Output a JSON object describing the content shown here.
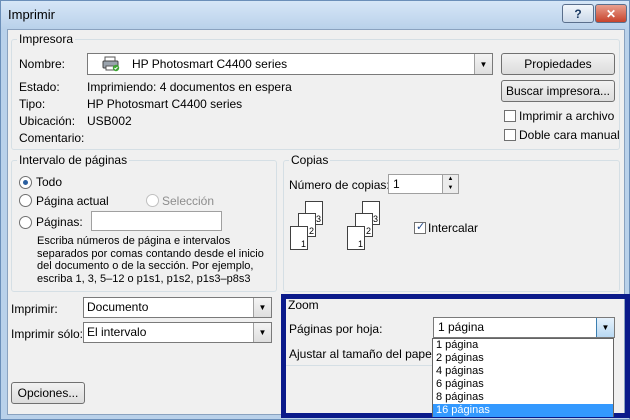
{
  "window": {
    "title": "Imprimir"
  },
  "printer": {
    "group_label": "Impresora",
    "name_label": "Nombre:",
    "name_value": "HP Photosmart C4400 series",
    "status_label": "Estado:",
    "status_value": "Imprimiendo: 4 documentos en espera",
    "type_label": "Tipo:",
    "type_value": "HP Photosmart C4400 series",
    "location_label": "Ubicación:",
    "location_value": "USB002",
    "comment_label": "Comentario:",
    "properties_button": "Propiedades",
    "find_button": "Buscar impresora...",
    "print_to_file": "Imprimir a archivo",
    "duplex": "Doble cara manual"
  },
  "page_range": {
    "group_label": "Intervalo de páginas",
    "all": "Todo",
    "current": "Página actual",
    "selection": "Selección",
    "pages": "Páginas:",
    "help_text": "Escriba números de página e intervalos separados por comas contando desde el inicio del documento o de la sección. Por ejemplo, escriba 1, 3, 5–12 o p1s1, p1s2, p1s3–p8s3"
  },
  "copies": {
    "group_label": "Copias",
    "count_label": "Número de copias:",
    "count_value": "1",
    "collate_label": "Intercalar",
    "page_nums": [
      "1",
      "2",
      "3"
    ]
  },
  "print_what": {
    "label": "Imprimir:",
    "value": "Documento"
  },
  "print_only": {
    "label": "Imprimir sólo:",
    "value": "El intervalo"
  },
  "zoom": {
    "group_label": "Zoom",
    "pages_per_sheet_label": "Páginas por hoja:",
    "pages_per_sheet_value": "1 página",
    "scale_label": "Ajustar al tamaño del papel:",
    "options": [
      "1 página",
      "2 páginas",
      "4 páginas",
      "6 páginas",
      "8 páginas",
      "16 páginas"
    ],
    "selected_option": "16 páginas"
  },
  "options_button": "Opciones..."
}
